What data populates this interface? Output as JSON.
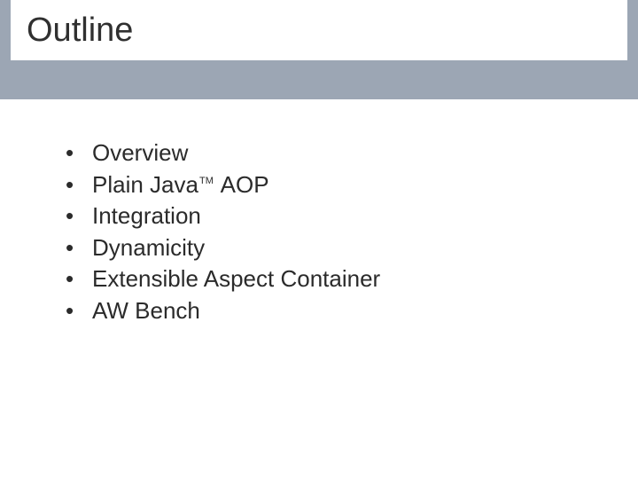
{
  "title": "Outline",
  "bullets": [
    {
      "text": "Overview"
    },
    {
      "pre": "Plain Java",
      "tm": "TM",
      "post": " AOP"
    },
    {
      "text": "Integration"
    },
    {
      "text": "Dynamicity"
    },
    {
      "text": "Extensible Aspect Container"
    },
    {
      "text": "AW Bench"
    }
  ]
}
